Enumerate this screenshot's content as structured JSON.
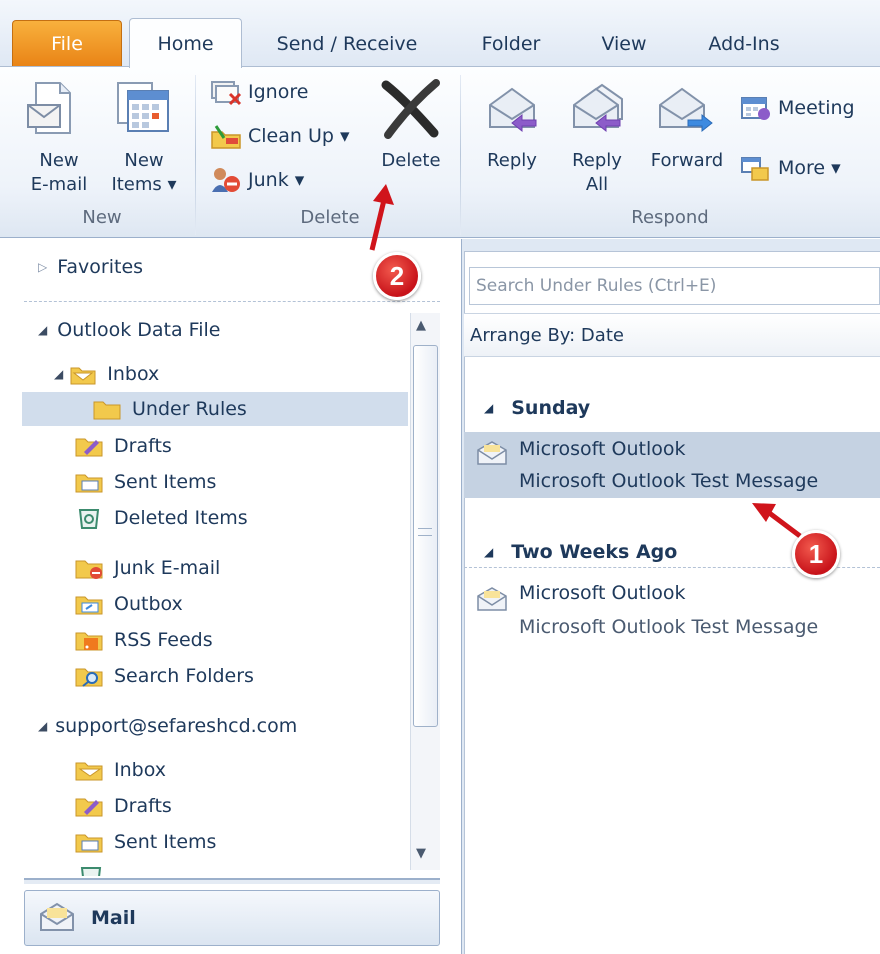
{
  "tabs": [
    {
      "label": "File"
    },
    {
      "label": "Home"
    },
    {
      "label": "Send / Receive"
    },
    {
      "label": "Folder"
    },
    {
      "label": "View"
    },
    {
      "label": "Add-Ins"
    }
  ],
  "ribbon": {
    "new_group": {
      "label": "New",
      "new_email": "New\nE-mail",
      "new_items": "New\nItems ▾"
    },
    "delete_group": {
      "label": "Delete",
      "ignore": "Ignore",
      "clean_up": "Clean Up ▾",
      "junk": "Junk ▾",
      "delete": "Delete"
    },
    "respond_group": {
      "label": "Respond",
      "reply": "Reply",
      "reply_all": "Reply\nAll",
      "forward": "Forward",
      "meeting": "Meeting",
      "more": "More ▾"
    }
  },
  "nav": {
    "favorites": "Favorites",
    "data_file": "Outlook Data File",
    "inbox": "Inbox",
    "under_rules": "Under Rules",
    "drafts": "Drafts",
    "sent_items": "Sent Items",
    "deleted_items": "Deleted Items",
    "junk_email": "Junk E-mail",
    "outbox": "Outbox",
    "rss_feeds": "RSS Feeds",
    "search_folders": "Search Folders",
    "account": "support@sefareshcd.com",
    "acc_inbox": "Inbox",
    "acc_drafts": "Drafts",
    "acc_sent": "Sent Items",
    "mail_button": "Mail"
  },
  "message_list": {
    "search_placeholder": "Search Under Rules (Ctrl+E)",
    "arrange_by": "Arrange By: Date",
    "groups": [
      {
        "label": "Sunday",
        "messages": [
          {
            "from": "Microsoft Outlook",
            "subject": "Microsoft Outlook Test Message",
            "selected": true
          }
        ]
      },
      {
        "label": "Two Weeks Ago",
        "messages": [
          {
            "from": "Microsoft Outlook",
            "subject": "Microsoft Outlook Test Message",
            "selected": false
          }
        ]
      }
    ]
  },
  "callouts": [
    {
      "number": "1"
    },
    {
      "number": "2"
    }
  ],
  "colors": {
    "file_tab": "#e98416",
    "selection": "#d1ddec",
    "callout": "#c8131a"
  }
}
